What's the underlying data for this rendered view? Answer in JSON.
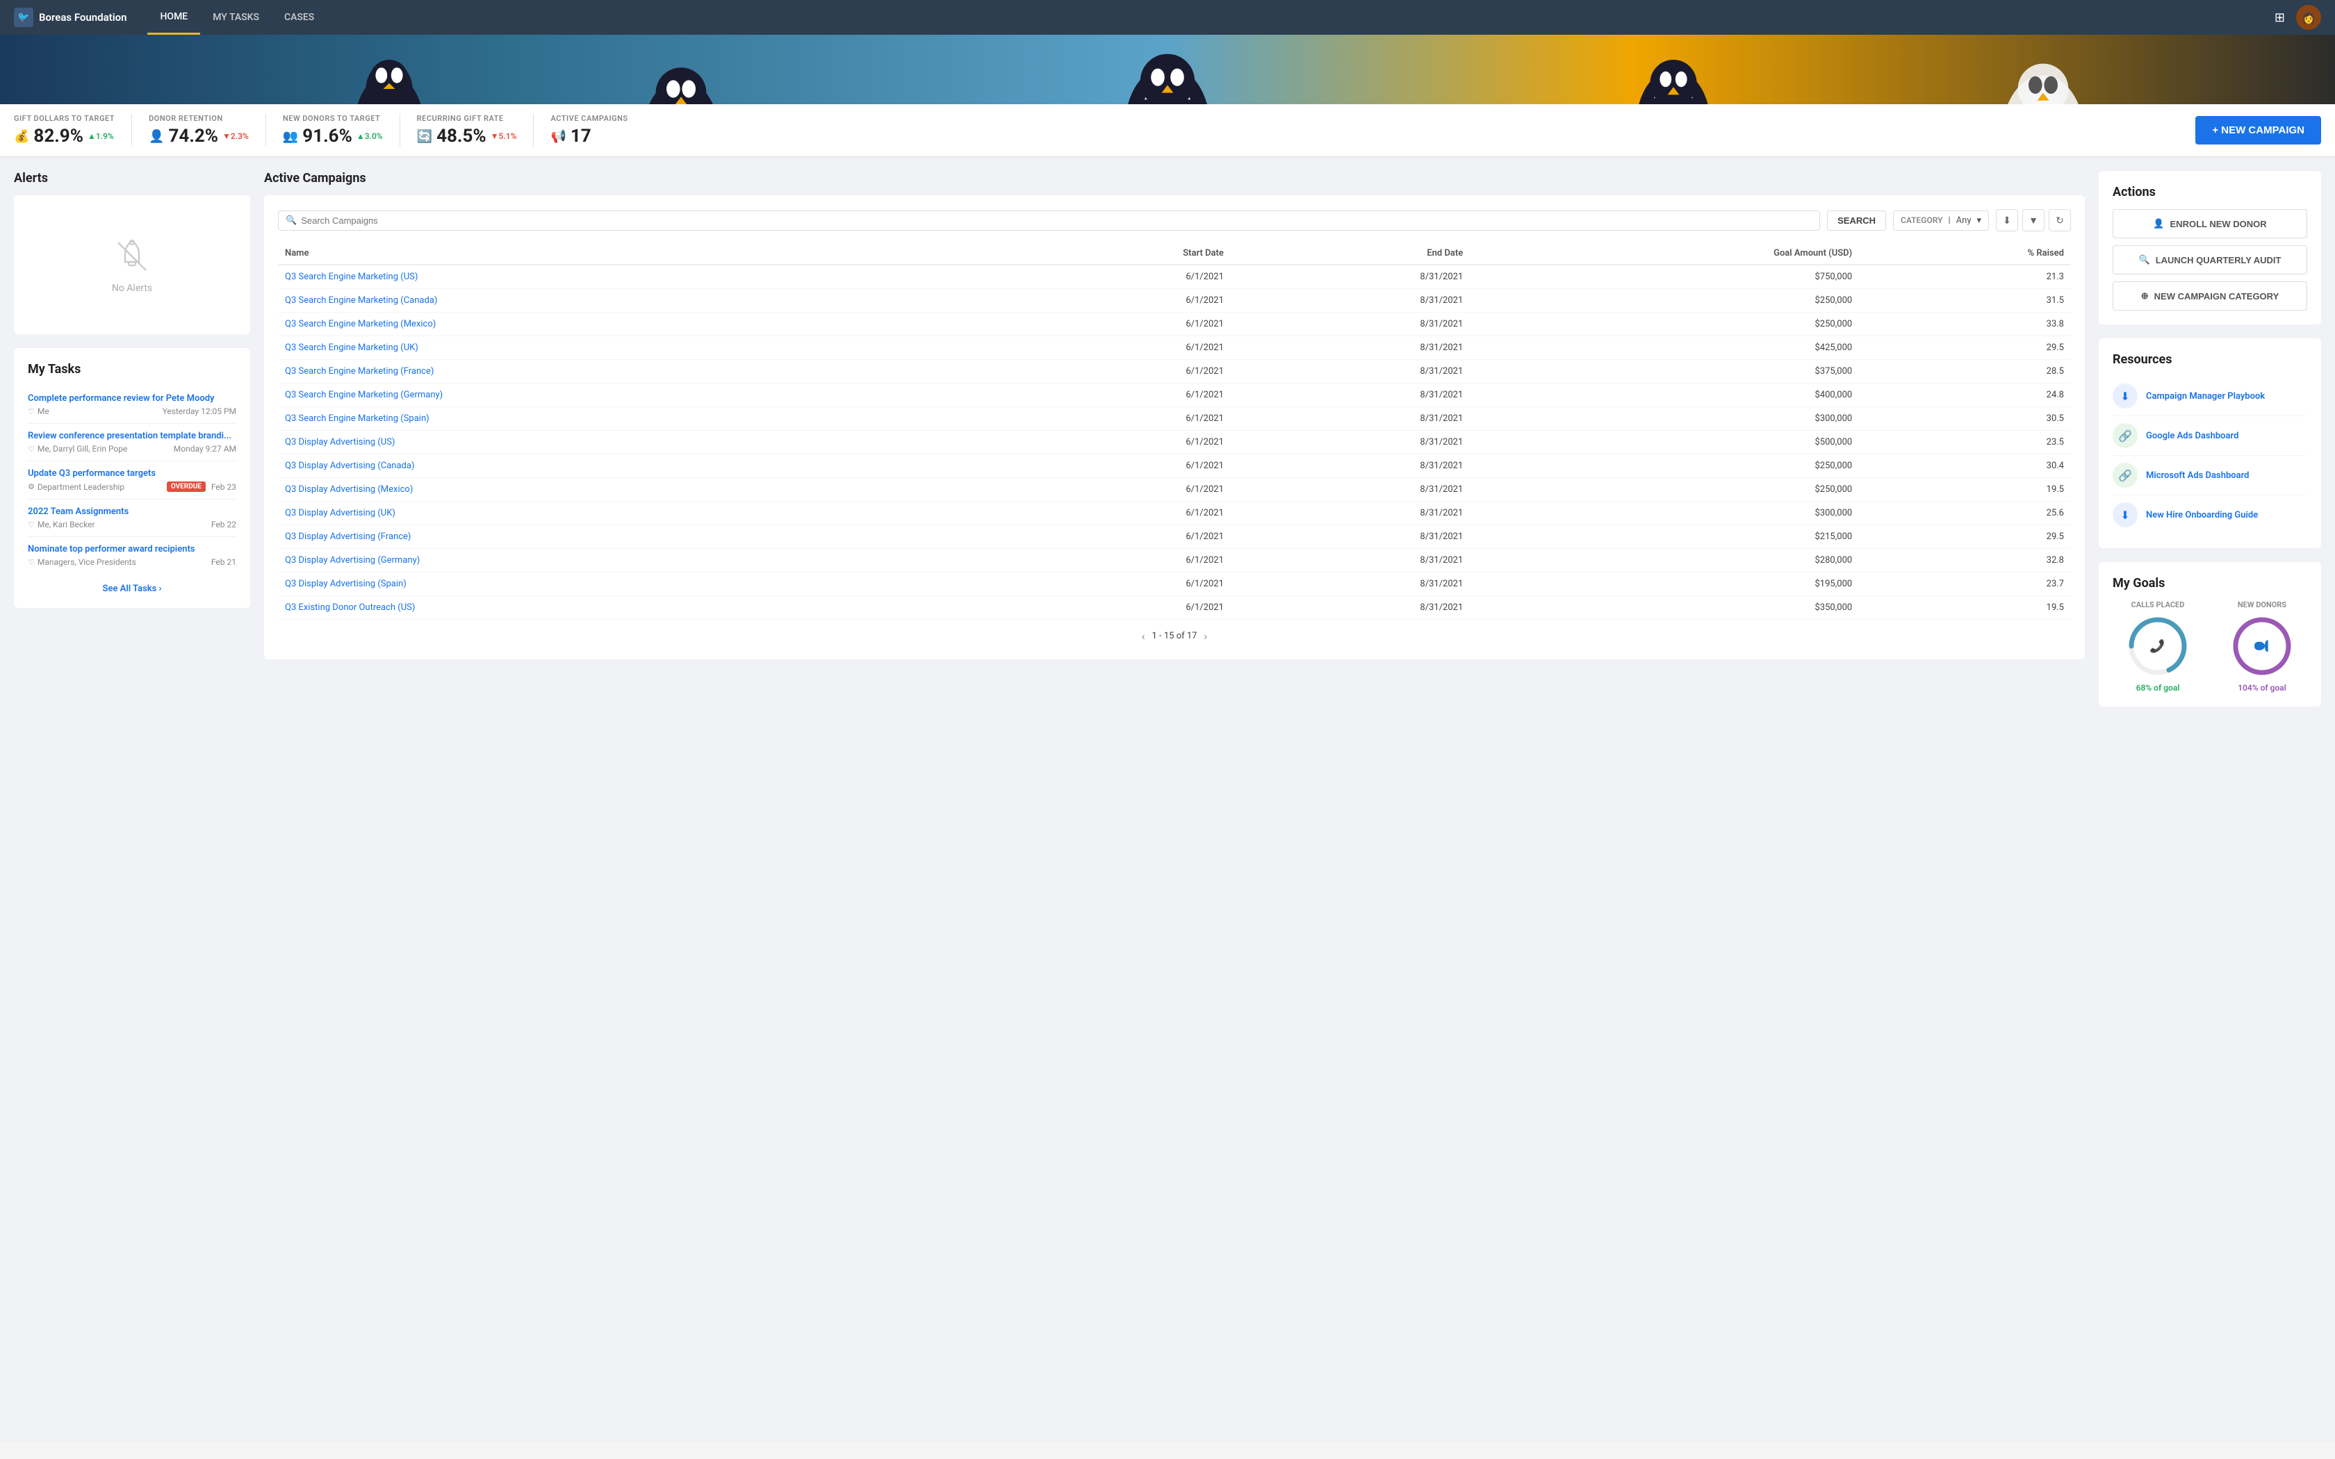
{
  "nav": {
    "logo": "Boreas Foundation",
    "links": [
      {
        "label": "HOME",
        "active": true
      },
      {
        "label": "MY TASKS",
        "active": false
      },
      {
        "label": "CASES",
        "active": false
      }
    ]
  },
  "stats": [
    {
      "label": "GIFT DOLLARS TO TARGET",
      "icon": "💰",
      "value": "82.9%",
      "change": "▲1.9%",
      "direction": "up"
    },
    {
      "label": "DONOR RETENTION",
      "icon": "👤",
      "value": "74.2%",
      "change": "▼2.3%",
      "direction": "down"
    },
    {
      "label": "NEW DONORS TO TARGET",
      "icon": "👥",
      "value": "91.6%",
      "change": "▲3.0%",
      "direction": "up"
    },
    {
      "label": "RECURRING GIFT RATE",
      "icon": "🔄",
      "value": "48.5%",
      "change": "▼5.1%",
      "direction": "down"
    },
    {
      "label": "ACTIVE CAMPAIGNS",
      "icon": "📢",
      "value": "17",
      "change": "",
      "direction": ""
    }
  ],
  "new_campaign_btn": "+ NEW CAMPAIGN",
  "alerts": {
    "title": "Alerts",
    "empty_text": "No Alerts"
  },
  "tasks": {
    "title": "My Tasks",
    "items": [
      {
        "title": "Complete performance review for Pete Moody",
        "assignee": "Me",
        "date": "Yesterday 12:05 PM",
        "overdue": false
      },
      {
        "title": "Review conference presentation template brandi...",
        "assignee": "Me, Darryl Gill, Erin Pope",
        "date": "Monday 9:27 AM",
        "overdue": false
      },
      {
        "title": "Update Q3 performance targets",
        "assignee": "Department Leadership",
        "date": "Feb 23",
        "overdue": true
      },
      {
        "title": "2022 Team Assignments",
        "assignee": "Me, Kari Becker",
        "date": "Feb 22",
        "overdue": false
      },
      {
        "title": "Nominate top performer award recipients",
        "assignee": "Managers, Vice Presidents",
        "date": "Feb 21",
        "overdue": false
      }
    ],
    "see_all": "See All Tasks ›"
  },
  "campaigns": {
    "title": "Active Campaigns",
    "search_placeholder": "Search Campaigns",
    "search_btn": "SEARCH",
    "category_label": "CATEGORY",
    "category_value": "Any",
    "columns": [
      "Name",
      "Start Date",
      "End Date",
      "Goal Amount (USD)",
      "% Raised"
    ],
    "rows": [
      {
        "name": "Q3 Search Engine Marketing (US)",
        "start": "6/1/2021",
        "end": "8/31/2021",
        "goal": "$750,000",
        "raised": "21.3"
      },
      {
        "name": "Q3 Search Engine Marketing (Canada)",
        "start": "6/1/2021",
        "end": "8/31/2021",
        "goal": "$250,000",
        "raised": "31.5"
      },
      {
        "name": "Q3 Search Engine Marketing (Mexico)",
        "start": "6/1/2021",
        "end": "8/31/2021",
        "goal": "$250,000",
        "raised": "33.8"
      },
      {
        "name": "Q3 Search Engine Marketing (UK)",
        "start": "6/1/2021",
        "end": "8/31/2021",
        "goal": "$425,000",
        "raised": "29.5"
      },
      {
        "name": "Q3 Search Engine Marketing (France)",
        "start": "6/1/2021",
        "end": "8/31/2021",
        "goal": "$375,000",
        "raised": "28.5"
      },
      {
        "name": "Q3 Search Engine Marketing (Germany)",
        "start": "6/1/2021",
        "end": "8/31/2021",
        "goal": "$400,000",
        "raised": "24.8"
      },
      {
        "name": "Q3 Search Engine Marketing (Spain)",
        "start": "6/1/2021",
        "end": "8/31/2021",
        "goal": "$300,000",
        "raised": "30.5"
      },
      {
        "name": "Q3 Display Advertising (US)",
        "start": "6/1/2021",
        "end": "8/31/2021",
        "goal": "$500,000",
        "raised": "23.5"
      },
      {
        "name": "Q3 Display Advertising (Canada)",
        "start": "6/1/2021",
        "end": "8/31/2021",
        "goal": "$250,000",
        "raised": "30.4"
      },
      {
        "name": "Q3 Display Advertising (Mexico)",
        "start": "6/1/2021",
        "end": "8/31/2021",
        "goal": "$250,000",
        "raised": "19.5"
      },
      {
        "name": "Q3 Display Advertising (UK)",
        "start": "6/1/2021",
        "end": "8/31/2021",
        "goal": "$300,000",
        "raised": "25.6"
      },
      {
        "name": "Q3 Display Advertising (France)",
        "start": "6/1/2021",
        "end": "8/31/2021",
        "goal": "$215,000",
        "raised": "29.5"
      },
      {
        "name": "Q3 Display Advertising (Germany)",
        "start": "6/1/2021",
        "end": "8/31/2021",
        "goal": "$280,000",
        "raised": "32.8"
      },
      {
        "name": "Q3 Display Advertising (Spain)",
        "start": "6/1/2021",
        "end": "8/31/2021",
        "goal": "$195,000",
        "raised": "23.7"
      },
      {
        "name": "Q3 Existing Donor Outreach (US)",
        "start": "6/1/2021",
        "end": "8/31/2021",
        "goal": "$350,000",
        "raised": "19.5"
      }
    ],
    "pagination": "1 - 15 of 17"
  },
  "actions": {
    "title": "Actions",
    "buttons": [
      {
        "icon": "👤",
        "label": "ENROLL NEW DONOR"
      },
      {
        "icon": "🔍",
        "label": "LAUNCH QUARTERLY AUDIT"
      },
      {
        "icon": "⊕",
        "label": "NEW CAMPAIGN CATEGORY"
      }
    ]
  },
  "resources": {
    "title": "Resources",
    "items": [
      {
        "icon": "⬇",
        "color": "blue",
        "label": "Campaign Manager Playbook"
      },
      {
        "icon": "🔗",
        "color": "green",
        "label": "Google Ads Dashboard"
      },
      {
        "icon": "🔗",
        "color": "green",
        "label": "Microsoft Ads Dashboard"
      },
      {
        "icon": "⬇",
        "color": "blue",
        "label": "New Hire Onboarding Guide"
      }
    ]
  },
  "goals": {
    "title": "My Goals",
    "items": [
      {
        "label": "CALLS PLACED",
        "pct": 68,
        "pct_label": "68% of goal",
        "color": "#4a9aba",
        "type": "phone"
      },
      {
        "label": "NEW DONORS",
        "pct": 104,
        "pct_label": "104% of goal",
        "color": "#9b59b6",
        "type": "person"
      }
    ]
  }
}
